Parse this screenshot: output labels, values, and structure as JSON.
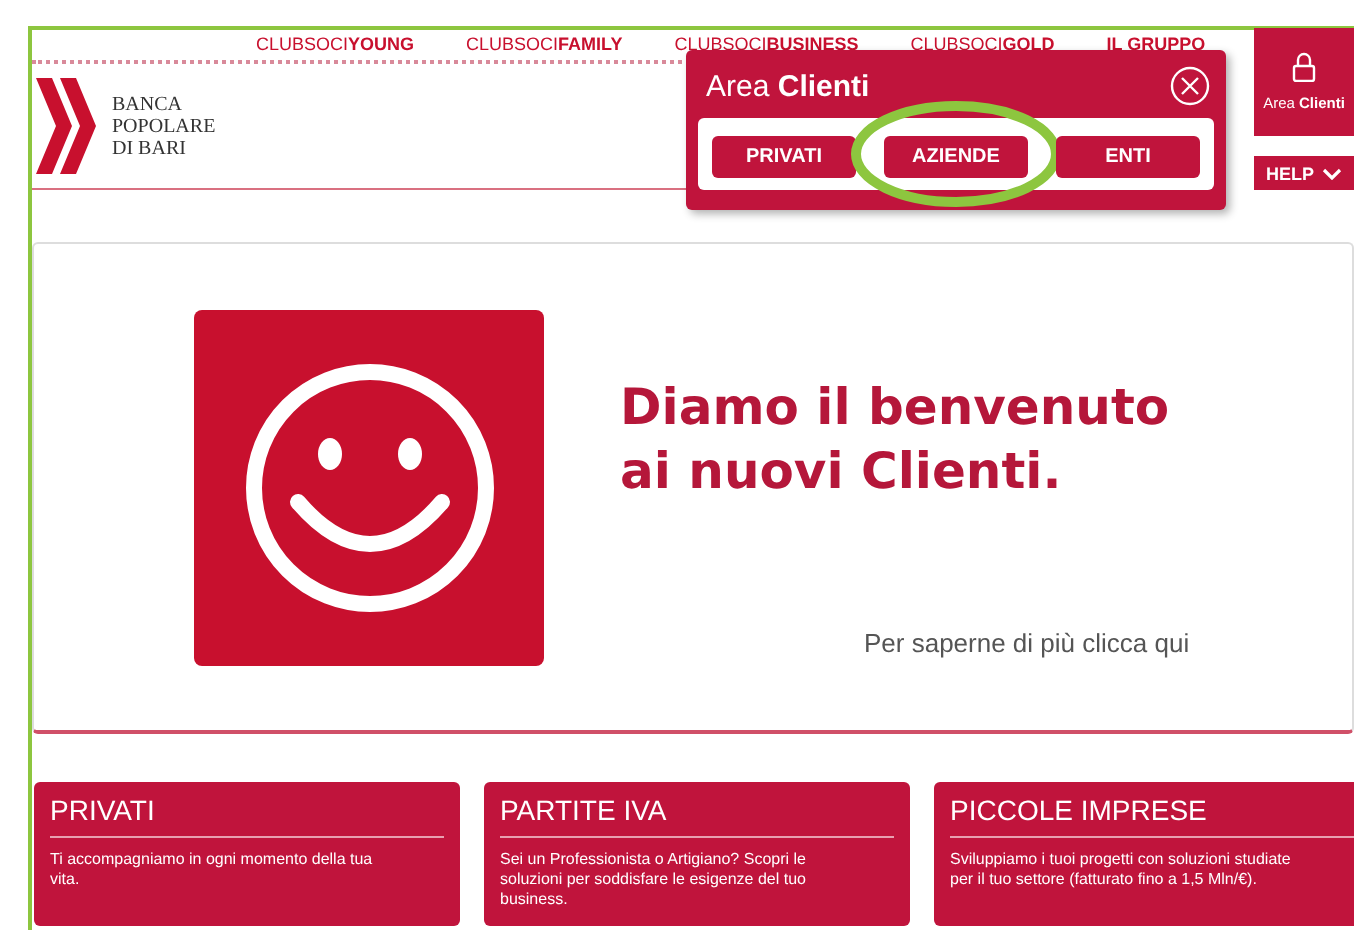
{
  "top_nav": [
    {
      "label": "CLUBSOCI**YOUNG**"
    },
    {
      "label": "CLUBSOCI**FAMILY**"
    },
    {
      "label": "CLUBSOCI**BUSINESS**"
    },
    {
      "label": "CLUBSOCI**GOLD**"
    },
    {
      "label": "**IL GRUPPO**"
    }
  ],
  "logo": {
    "lines": [
      "BANCA",
      "POPOLARE",
      "DI BARI"
    ]
  },
  "area_tab": {
    "label": "Area **Clienti**"
  },
  "help_button": {
    "label": "HELP"
  },
  "popup": {
    "title": "Area **Clienti**",
    "buttons": [
      {
        "label": "PRIVATI",
        "highlighted": false
      },
      {
        "label": "AZIENDE",
        "highlighted": true
      },
      {
        "label": "ENTI",
        "highlighted": false
      }
    ]
  },
  "hero": {
    "heading": [
      "Diamo il benvenuto",
      "ai nuovi Clienti."
    ],
    "link": "Per saperne di più clicca qui"
  },
  "cards": [
    {
      "title": "PRIVATI",
      "text": "Ti accompagniamo in ogni momento della tua vita."
    },
    {
      "title": "PARTITE IVA",
      "text": "Sei un Professionista o Artigiano? Scopri le soluzioni per soddisfare le esigenze del tuo business."
    },
    {
      "title": "PICCOLE IMPRESE",
      "text": "Sviluppiamo i tuoi progetti con soluzioni studiate per il tuo settore (fatturato fino a 1,5 Mln/€)."
    }
  ]
}
